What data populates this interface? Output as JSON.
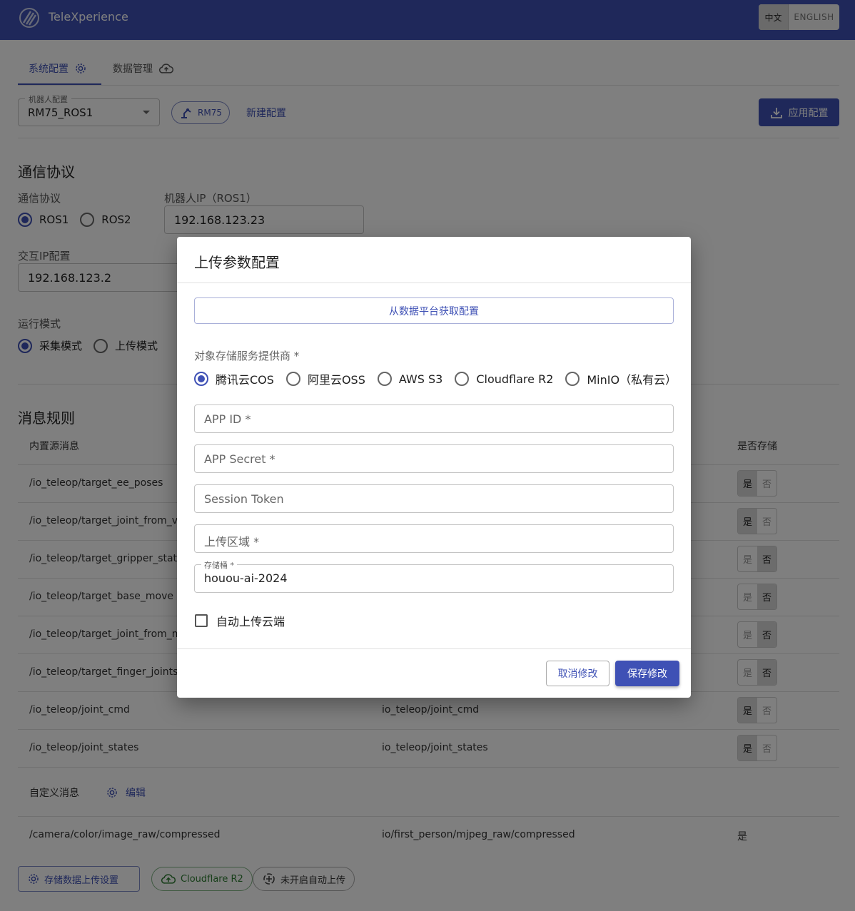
{
  "app": {
    "title": "TeleXperience"
  },
  "lang": {
    "zh": "中文",
    "en": "ENGLISH"
  },
  "tabs": [
    {
      "label": "系统配置",
      "icon": "gear-icon"
    },
    {
      "label": "数据管理",
      "icon": "cloud-upload-icon"
    }
  ],
  "robot_config": {
    "legend": "机器人配置",
    "value": "RM75_ROS1",
    "chip_label": "RM75",
    "new_config": "新建配置",
    "apply": "应用配置"
  },
  "comm": {
    "section_title": "通信协议",
    "protocol_label": "通信协议",
    "protocols": [
      "ROS1",
      "ROS2"
    ],
    "robot_ip_label": "机器人IP（ROS1）",
    "robot_ip": "192.168.123.23",
    "interact_ip_label": "交互IP配置",
    "interact_ip": "192.168.123.2",
    "mode_label": "运行模式",
    "modes": [
      "采集模式",
      "上传模式"
    ]
  },
  "rules": {
    "section_title": "消息规则",
    "col_builtin": "内置源消息",
    "col_store": "是否存储",
    "yes": "是",
    "no": "否",
    "rows": [
      {
        "src": "/io_teleop/target_ee_poses",
        "dst": "",
        "store": "yes"
      },
      {
        "src": "/io_teleop/target_joint_from_vr",
        "dst": "",
        "store": "yes"
      },
      {
        "src": "/io_teleop/target_gripper_status",
        "dst": "",
        "store": "no"
      },
      {
        "src": "/io_teleop/target_base_move",
        "dst": "",
        "store": "no"
      },
      {
        "src": "/io_teleop/target_joint_from_mo",
        "dst": "",
        "store": "no"
      },
      {
        "src": "/io_teleop/target_finger_joints",
        "dst": "",
        "store": "no"
      },
      {
        "src": "/io_teleop/joint_cmd",
        "dst": "io_teleop/joint_cmd",
        "store": "yes"
      },
      {
        "src": "/io_teleop/joint_states",
        "dst": "io_teleop/joint_states",
        "store": "yes"
      }
    ],
    "custom_label": "自定义消息",
    "edit_label": "编辑",
    "custom_row": {
      "src": "/camera/color/image_raw/compressed",
      "dst": "io/first_person/mjpeg_raw/compressed",
      "store": "是"
    }
  },
  "bottom": {
    "upload_settings": "存储数据上传设置",
    "provider_chip": "Cloudflare R2",
    "auto_chip": "未开启自动上传"
  },
  "dialog": {
    "title": "上传参数配置",
    "fetch_button": "从数据平台获取配置",
    "provider_label": "对象存储服务提供商 *",
    "providers": [
      "腾讯云COS",
      "阿里云OSS",
      "AWS S3",
      "Cloudflare R2",
      "MinIO（私有云）"
    ],
    "selected_provider": "腾讯云COS",
    "app_id_ph": "APP ID *",
    "app_secret_ph": "APP Secret *",
    "session_token_ph": "Session Token",
    "region_ph": "上传区域 *",
    "bucket_label": "存储桶 *",
    "bucket_value": "houou-ai-2024",
    "auto_upload": "自动上传云端",
    "cancel": "取消修改",
    "save": "保存修改"
  },
  "colors": {
    "primary": "#3f51b5",
    "appbar": "#3f51b5"
  }
}
